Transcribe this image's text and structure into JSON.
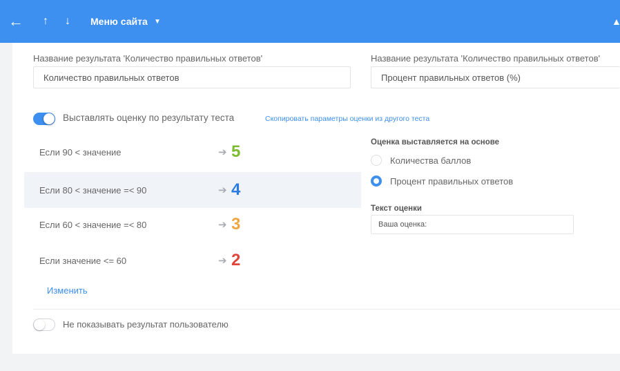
{
  "topbar": {
    "back_icon": "arrow-left-icon",
    "up_icon": "arrow-up-icon",
    "down_icon": "arrow-down-icon",
    "menu_label": "Меню сайта",
    "caret_icon": "caret-down-icon",
    "user_icon": "user-icon",
    "color": "#3d8ff0"
  },
  "result_names": {
    "count": {
      "label": "Название результата 'Количество правильных ответов'",
      "value": "Количество правильных ответов"
    },
    "percent": {
      "label": "Название результата 'Количество правильных ответов'",
      "value": "Процент правильных ответов (%)"
    }
  },
  "grading": {
    "toggle_label": "Выставлять оценку по результату теста",
    "toggle_on": true,
    "copy_link": "Скопировать параметры оценки из другого теста",
    "rules": [
      {
        "condition": "Если 90 < значение",
        "grade": "5",
        "color": "#7dbb2f"
      },
      {
        "condition": "Если 80 < значение =< 90",
        "grade": "4",
        "color": "#2d7ce0"
      },
      {
        "condition": "Если 60 < значение =< 80",
        "grade": "3",
        "color": "#f0a640"
      },
      {
        "condition": "Если значение <= 60",
        "grade": "2",
        "color": "#e0453a"
      }
    ],
    "edit_link": "Изменить"
  },
  "basis": {
    "title": "Оценка выставляется на основе",
    "options": [
      {
        "label": "Количества баллов",
        "selected": false
      },
      {
        "label": "Процент правильных ответов",
        "selected": true
      }
    ]
  },
  "grade_text": {
    "title": "Текст оценки",
    "value": "Ваша оценка:"
  },
  "hide_result": {
    "label": "Не показывать результат пользователю",
    "toggle_on": false
  }
}
